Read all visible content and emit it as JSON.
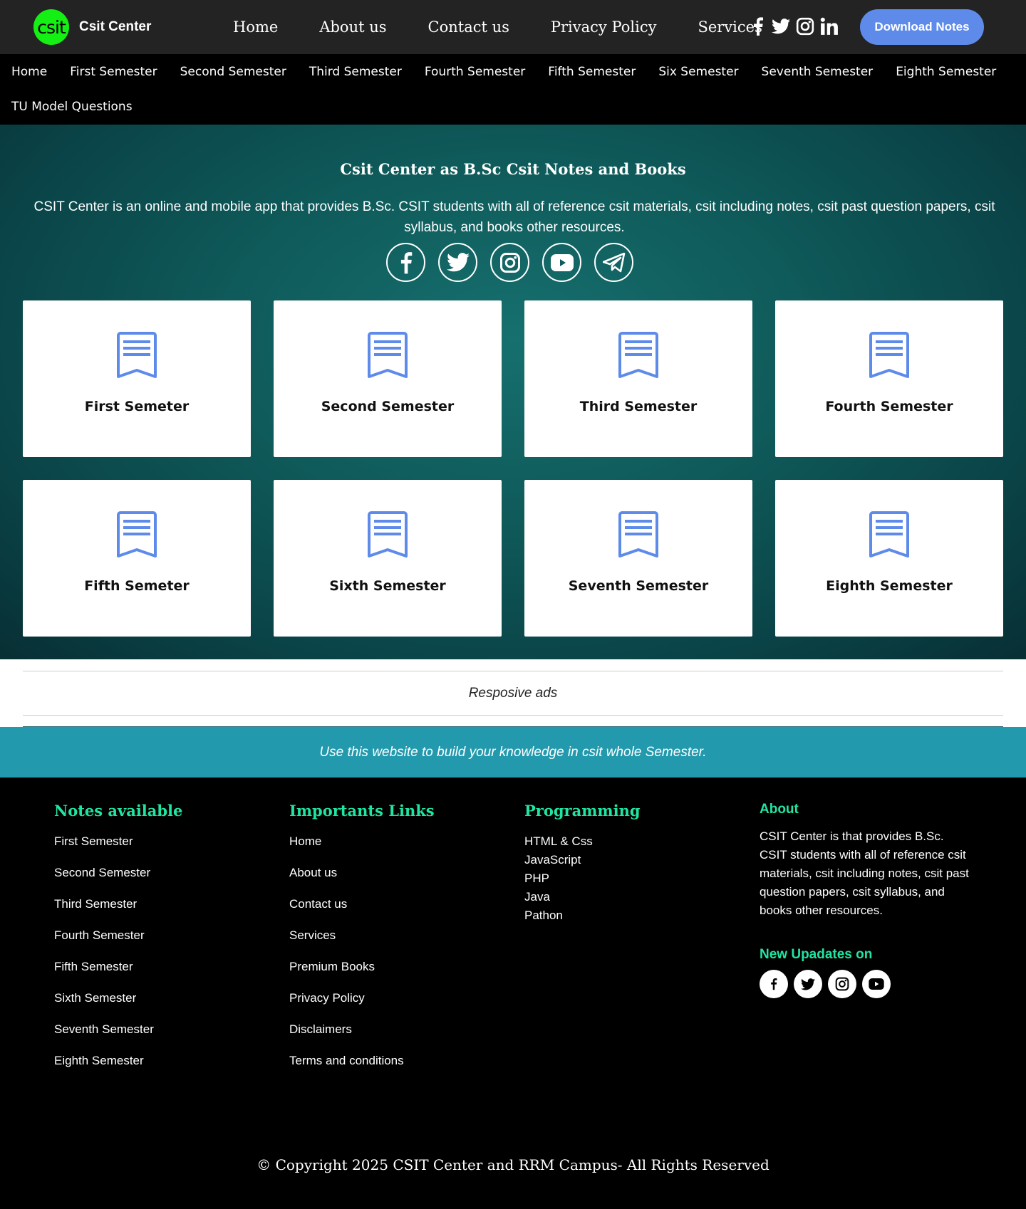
{
  "brand": {
    "logo_text": "csit",
    "name": "Csit Center"
  },
  "main_nav": [
    "Home",
    "About us",
    "Contact us",
    "Privacy Policy",
    "Services"
  ],
  "download_button": "Download Notes",
  "semester_menu": {
    "row1": [
      "Home",
      "First Semester",
      "Second Semester",
      "Third Semester",
      "Fourth Semester",
      "Fifth Semester",
      "Six Semester",
      "Seventh Semester",
      "Eighth Semester"
    ],
    "row2": [
      "TU Model Questions"
    ]
  },
  "hero": {
    "title": "Csit Center as B.Sc Csit Notes and Books",
    "description": "CSIT Center is an online and mobile app that provides B.Sc. CSIT students with all of reference csit materials, csit including notes, csit past question papers, csit syllabus, and books other resources.",
    "social_icons": [
      "facebook-icon",
      "twitter-icon",
      "instagram-icon",
      "youtube-icon",
      "telegram-icon"
    ]
  },
  "semester_cards": [
    "First Semeter",
    "Second Semester",
    "Third Semester",
    "Fourth Semester",
    "Fifth Semeter",
    "Sixth Semester",
    "Seventh Semester",
    "Eighth Semester"
  ],
  "ads": {
    "label": "Resposive ads"
  },
  "banner": {
    "text": "Use this website to build your knowledge in csit whole Semester."
  },
  "footer": {
    "notes": {
      "heading": "Notes available",
      "links": [
        "First Semester",
        "Second Semester",
        "Third Semester",
        "Fourth Semester",
        "Fifth Semester",
        "Sixth Semester",
        "Seventh Semester",
        "Eighth Semester"
      ]
    },
    "important": {
      "heading": "Importants Links",
      "links": [
        "Home",
        "About us",
        "Contact us",
        "Services",
        "Premium Books",
        "Privacy Policy",
        "Disclaimers",
        "Terms and conditions"
      ]
    },
    "programming": {
      "heading": "Programming",
      "links": [
        "HTML & Css",
        "JavaScript",
        "PHP",
        "Java",
        "Pathon"
      ]
    },
    "about": {
      "heading": "About",
      "text": "CSIT Center is that provides B.Sc. CSIT students with all of reference csit materials, csit including notes, csit past question papers, csit syllabus, and books other resources.",
      "updates_heading": "New Upadates on"
    },
    "copyright": "© Copyright 2025  CSIT Center and RRM Campus- All Rights Reserved"
  },
  "colors": {
    "accent_blue": "#5e8bea",
    "footer_heading": "#1fe5a1",
    "banner_teal": "#2399ad",
    "logo_green": "#14f014"
  }
}
